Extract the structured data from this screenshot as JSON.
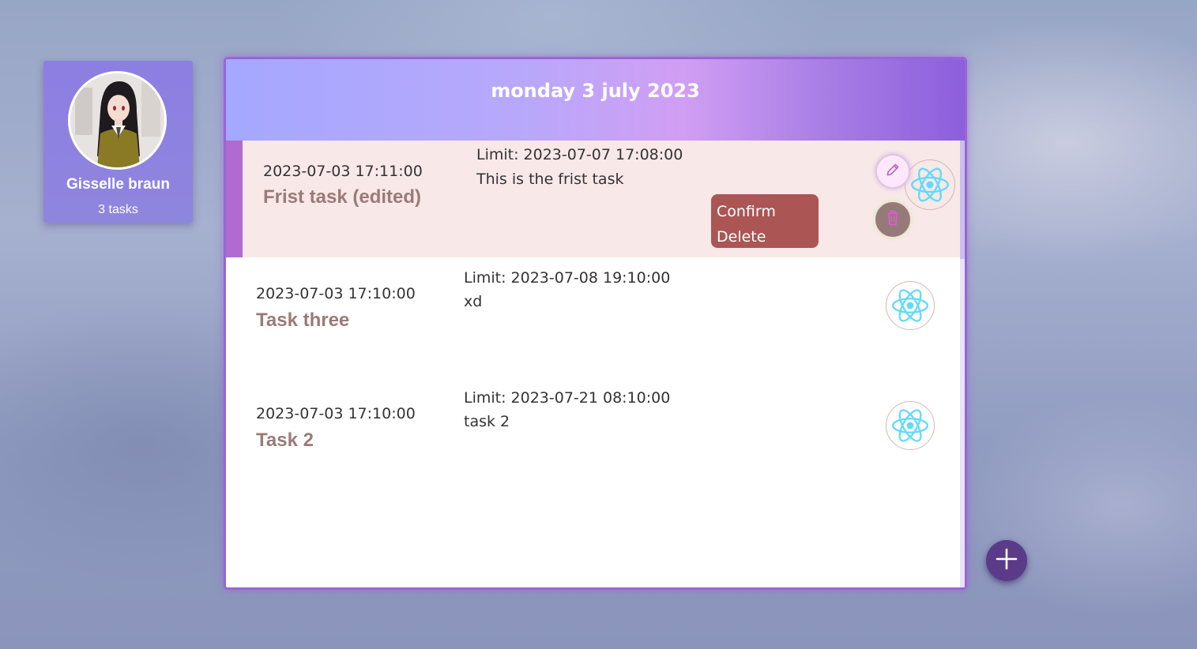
{
  "profile": {
    "name": "Gisselle braun",
    "task_count": "3 tasks"
  },
  "panel": {
    "date_title": "monday 3 july 2023"
  },
  "tasks": [
    {
      "created": "2023-07-03 17:11:00",
      "title": "Frist task (edited)",
      "limit": "Limit: 2023-07-07 17:08:00",
      "description": "This is the frist task",
      "selected": true
    },
    {
      "created": "2023-07-03 17:10:00",
      "title": "Task three",
      "limit": "Limit: 2023-07-08 19:10:00",
      "description": "xd",
      "selected": false
    },
    {
      "created": "2023-07-03 17:10:00",
      "title": "Task 2",
      "limit": "Limit: 2023-07-21 08:10:00",
      "description": "task 2",
      "selected": false
    }
  ],
  "actions": {
    "confirm_delete_line1": "Confirm",
    "confirm_delete_line2": "Delete"
  },
  "icons": {
    "edit": "pencil-icon",
    "delete": "trash-icon",
    "task_badge": "react-logo-icon",
    "add": "plus-icon"
  },
  "colors": {
    "accent": "#8d7ee2",
    "selected_row": "#f8e8e8",
    "title_text": "#9a7b78",
    "confirm_delete": "#ab5554",
    "add_button": "#5b3a8a"
  }
}
